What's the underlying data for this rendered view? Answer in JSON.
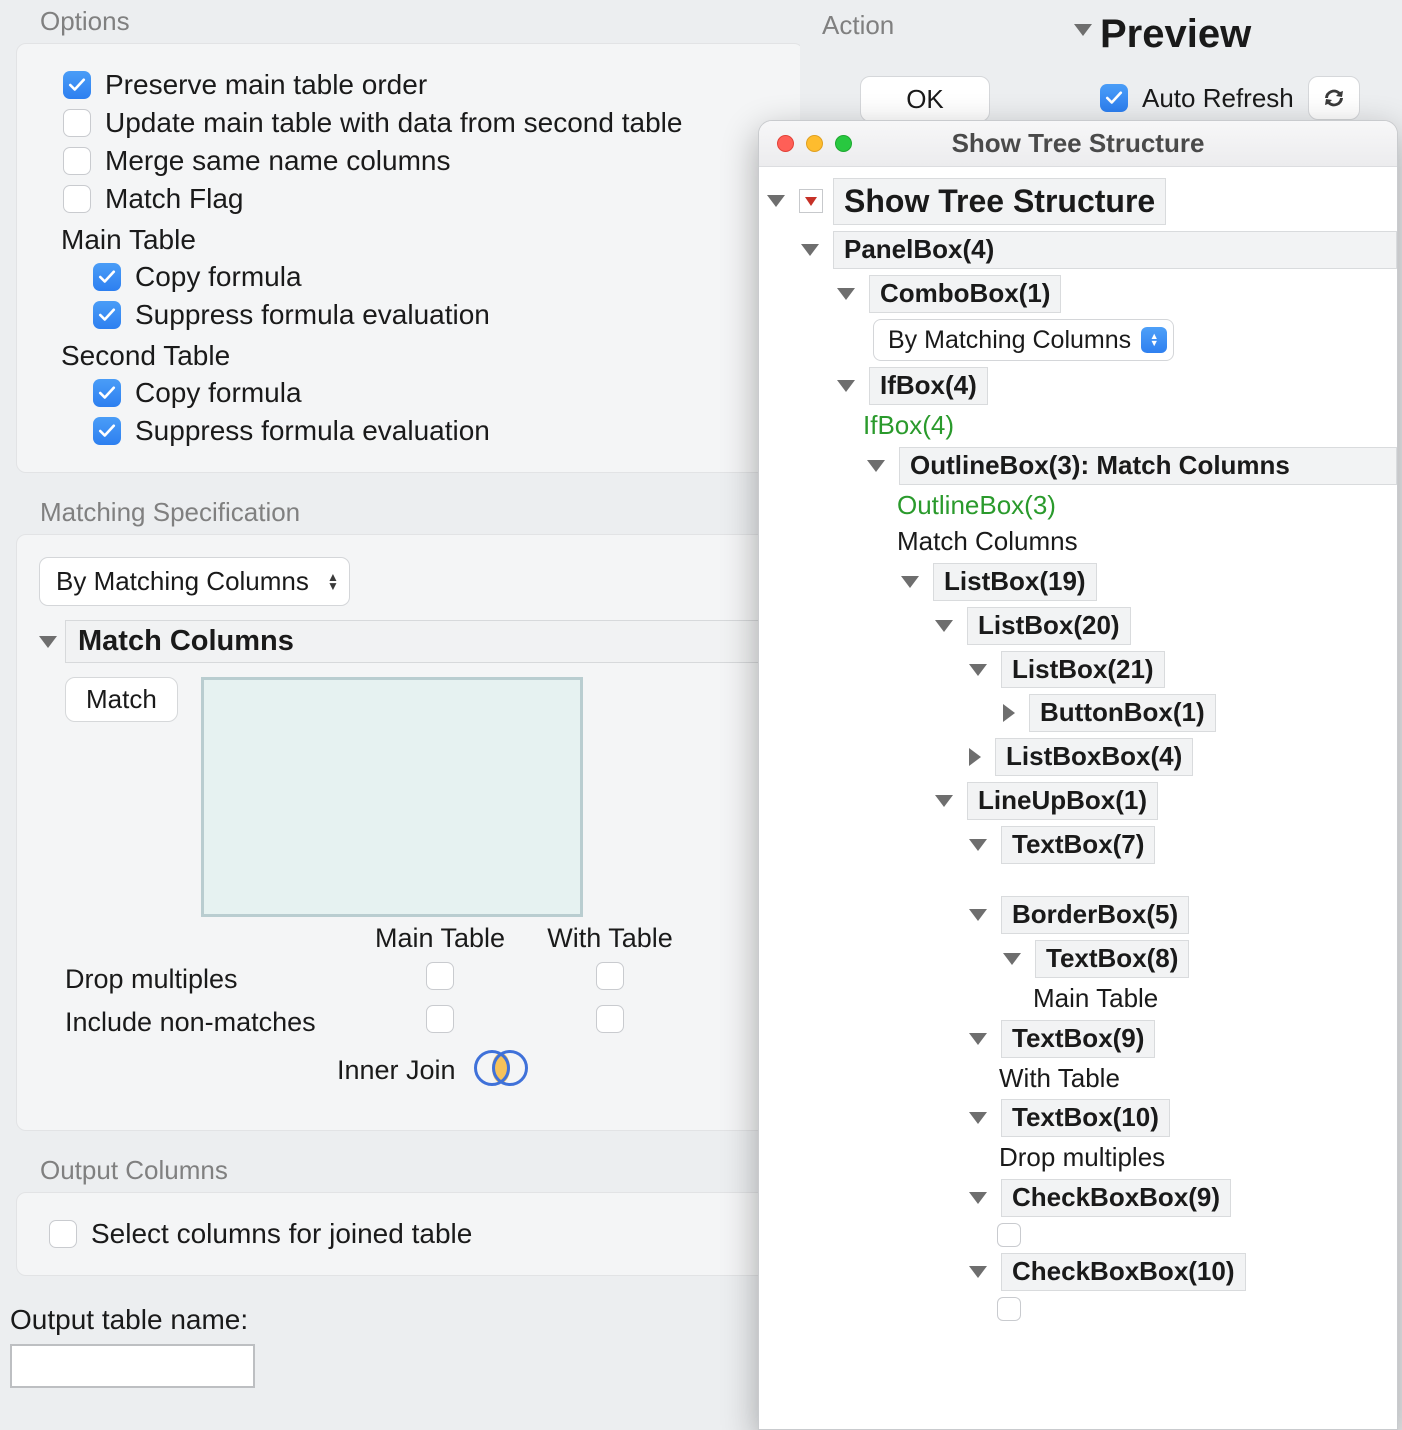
{
  "options": {
    "section_label": "Options",
    "items": [
      {
        "label": "Preserve main table order",
        "checked": true
      },
      {
        "label": "Update main table with data from second table",
        "checked": false
      },
      {
        "label": "Merge same name columns",
        "checked": false
      },
      {
        "label": "Match Flag",
        "checked": false
      }
    ],
    "main_table_label": "Main Table",
    "main_table_items": [
      {
        "label": "Copy formula",
        "checked": true
      },
      {
        "label": "Suppress formula evaluation",
        "checked": true
      }
    ],
    "second_table_label": "Second Table",
    "second_table_items": [
      {
        "label": "Copy formula",
        "checked": true
      },
      {
        "label": "Suppress formula evaluation",
        "checked": true
      }
    ]
  },
  "matching": {
    "section_label": "Matching Specification",
    "by_select": "By Matching Columns",
    "match_columns_title": "Match Columns",
    "match_button": "Match",
    "col_main": "Main Table",
    "col_with": "With Table",
    "row_drop": "Drop multiples",
    "row_incl": "Include non-matches",
    "join_label": "Inner Join"
  },
  "output": {
    "section_label": "Output Columns",
    "select_cols": "Select columns for joined table",
    "table_name_label": "Output table name:",
    "table_name_value": ""
  },
  "top_right": {
    "action": "Action",
    "ok": "OK",
    "preview": "Preview",
    "auto_refresh": "Auto Refresh"
  },
  "tree": {
    "window_title": "Show Tree Structure",
    "root": "Show Tree Structure",
    "panelbox": "PanelBox(4)",
    "combobox": "ComboBox(1)",
    "combo_value": "By Matching Columns",
    "ifbox": "IfBox(4)",
    "ifbox_green": "IfBox(4)",
    "outlinebox": "OutlineBox(3): Match Columns",
    "outlinebox_green": "OutlineBox(3)",
    "match_columns_plain": "Match Columns",
    "listbox19": "ListBox(19)",
    "listbox20": "ListBox(20)",
    "listbox21": "ListBox(21)",
    "buttonbox1": "ButtonBox(1)",
    "listboxbox4": "ListBoxBox(4)",
    "lineupbox1": "LineUpBox(1)",
    "textbox7": "TextBox(7)",
    "borderbox5": "BorderBox(5)",
    "textbox8": "TextBox(8)",
    "maintable_text": "Main Table",
    "textbox9": "TextBox(9)",
    "withtable_text": "With Table",
    "textbox10": "TextBox(10)",
    "dropmult_text": "Drop multiples",
    "checkboxbox9": "CheckBoxBox(9)",
    "checkboxbox10": "CheckBoxBox(10)"
  }
}
